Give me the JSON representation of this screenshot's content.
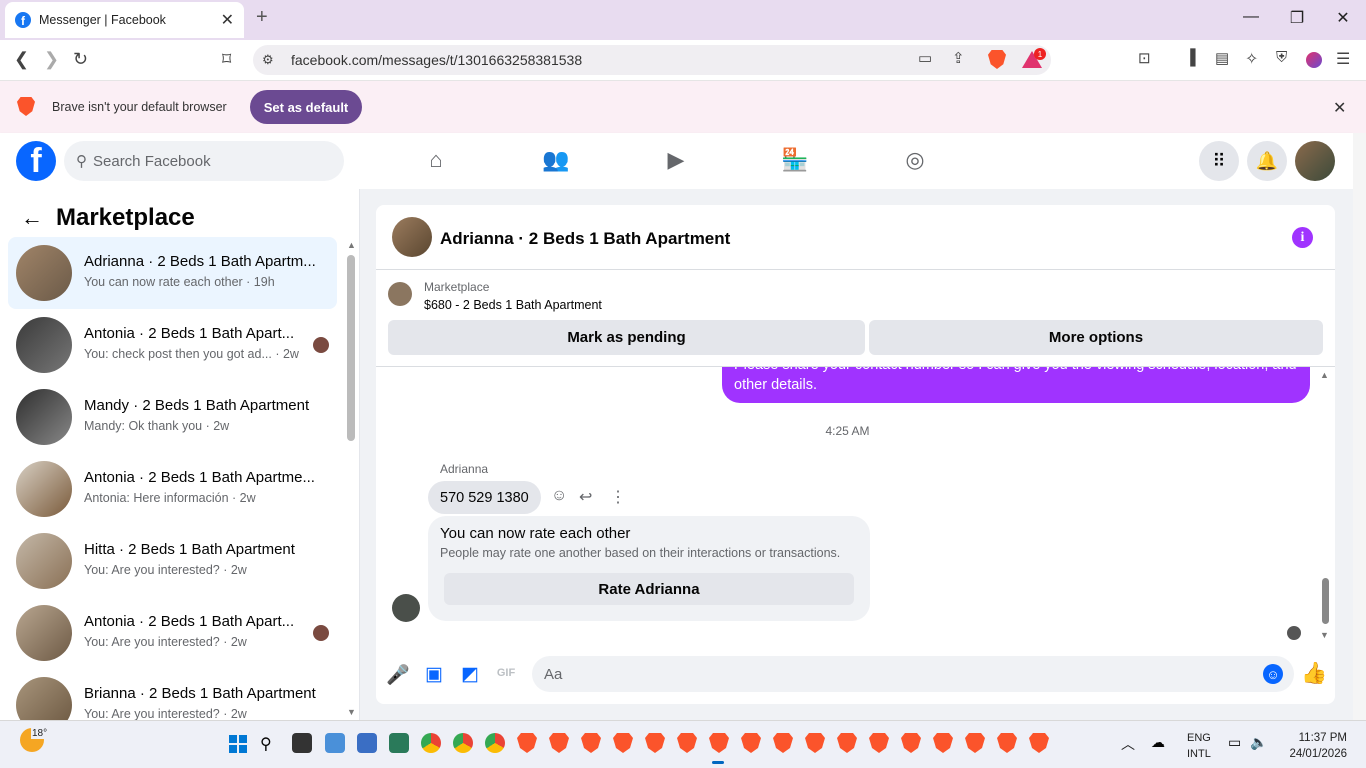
{
  "browser": {
    "tab_title": "Messenger | Facebook",
    "url": "facebook.com/messages/t/1301663258381538",
    "notification_badge": "1"
  },
  "infobar": {
    "text": "Brave isn't your default browser",
    "button": "Set as default"
  },
  "fb": {
    "search_placeholder": "Search Facebook",
    "brand_color": "#0866ff"
  },
  "sidebar": {
    "title": "Marketplace",
    "conversations": [
      {
        "name": "Adrianna · 2 Beds 1 Bath Apartm...",
        "snippet": "You can now rate each other · 19h"
      },
      {
        "name": "Antonia · 2 Beds 1 Bath Apart...",
        "snippet": "You: check post then you got ad... · 2w"
      },
      {
        "name": "Mandy · 2 Beds 1 Bath Apartment",
        "snippet": "Mandy: Ok thank you · 2w"
      },
      {
        "name": "Antonia · 2 Beds 1 Bath Apartme...",
        "snippet": "Antonia: Here información · 2w"
      },
      {
        "name": "Hitta · 2 Beds 1 Bath Apartment",
        "snippet": "You: Are you interested? · 2w"
      },
      {
        "name": "Antonia · 2 Beds 1 Bath Apart...",
        "snippet": "You: Are you interested? · 2w"
      },
      {
        "name": "Brianna · 2 Beds 1 Bath Apartment",
        "snippet": "You: Are you interested? · 2w"
      }
    ]
  },
  "chat": {
    "title": "Adrianna · 2 Beds 1 Bath Apartment",
    "marketplace_label": "Marketplace",
    "listing": "$680 - 2 Beds 1 Bath Apartment",
    "mark_pending": "Mark as pending",
    "more_options": "More options",
    "outgoing_text": "Please share your contact number so I can give you the viewing schedule, location, and other details.",
    "time": "4:25 AM",
    "sender": "Adrianna",
    "incoming_text": "570 529 1380",
    "rate_title": "You can now rate each other",
    "rate_desc": "People may rate one another based on their interactions or transactions.",
    "rate_button": "Rate Adrianna",
    "composer_placeholder": "Aa",
    "accent": "#a033ff"
  },
  "taskbar": {
    "temperature": "18°",
    "lang1": "ENG",
    "lang2": "INTL",
    "time": "11:37 PM",
    "date": "24/01/2026"
  }
}
